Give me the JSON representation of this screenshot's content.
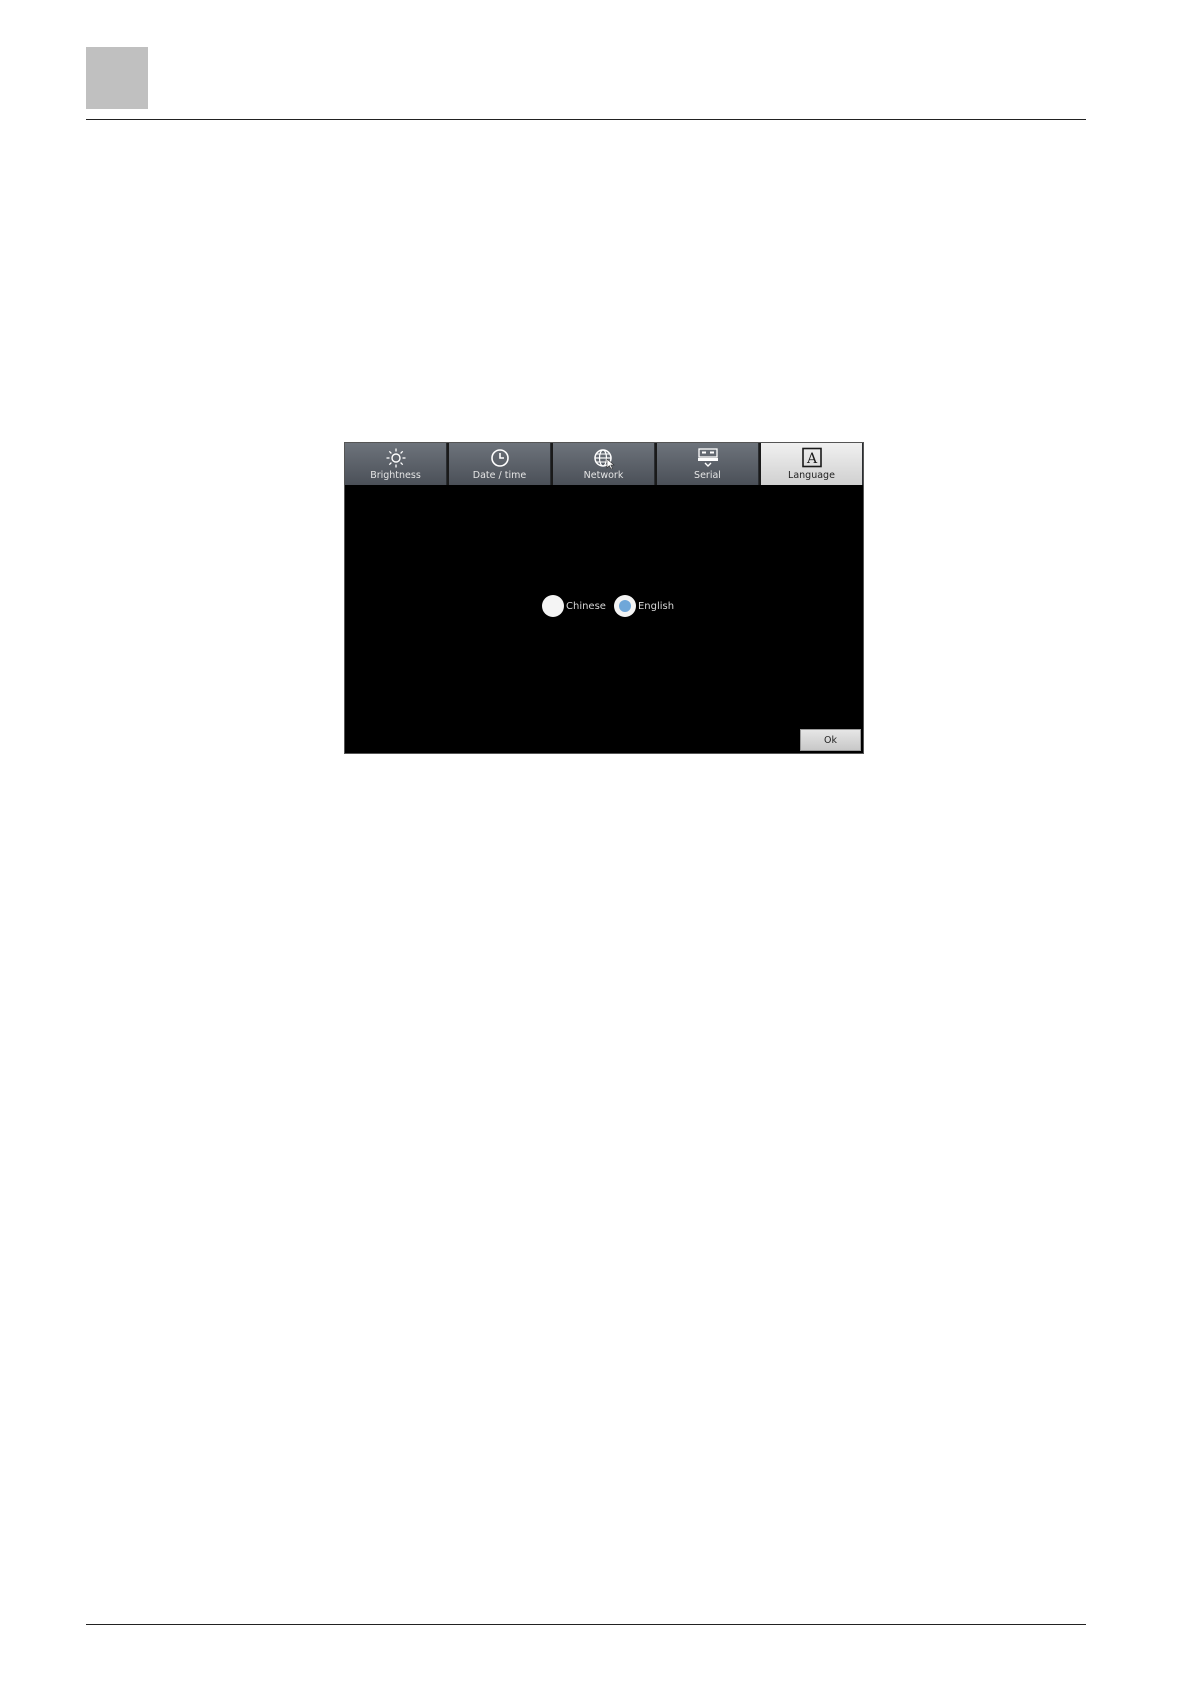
{
  "device_ui": {
    "tabs": [
      {
        "label": "Brightness",
        "icon": "brightness-icon",
        "active": false
      },
      {
        "label": "Date / time",
        "icon": "clock-icon",
        "active": false
      },
      {
        "label": "Network",
        "icon": "globe-icon",
        "active": false
      },
      {
        "label": "Serial",
        "icon": "serial-port-icon",
        "active": false
      },
      {
        "label": "Language",
        "icon": "language-a-icon",
        "active": true
      }
    ],
    "language_options": [
      {
        "label": "Chinese",
        "selected": false
      },
      {
        "label": "English",
        "selected": true
      }
    ],
    "ok_label": "Ok",
    "colors": {
      "screen_background": "#000000",
      "tab_inactive": "#5c6169",
      "tab_active": "#e4e4e4",
      "radio_selected_fill": "#6fa7d9"
    }
  }
}
